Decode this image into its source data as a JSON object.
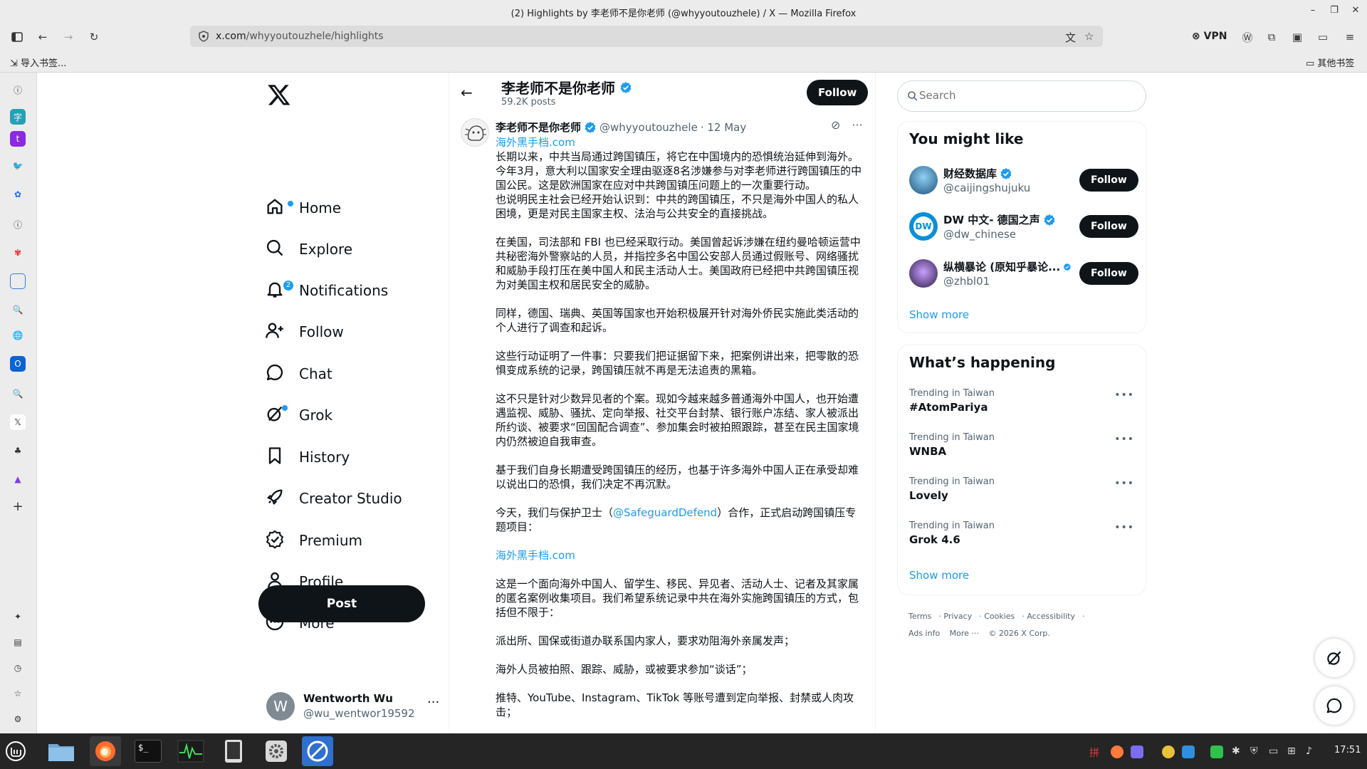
{
  "window": {
    "title": "(2) Highlights by 李老师不是你老师 (@whyyoutouzhele) / X — Mozilla Firefox"
  },
  "browser": {
    "url_domain": "x.com",
    "url_path": "/whyyoutouzhele/highlights",
    "vpn_label": "VPN",
    "bookmarks_import": "导入书签...",
    "bookmarks_other": "其他书签"
  },
  "nav": {
    "items": [
      {
        "label": "Home",
        "icon": "home-icon"
      },
      {
        "label": "Explore",
        "icon": "search-icon"
      },
      {
        "label": "Notifications",
        "icon": "bell-icon",
        "badge": "2"
      },
      {
        "label": "Follow",
        "icon": "add-person-icon"
      },
      {
        "label": "Chat",
        "icon": "chat-icon"
      },
      {
        "label": "Grok",
        "icon": "grok-icon"
      },
      {
        "label": "History",
        "icon": "bookmark-icon"
      },
      {
        "label": "Creator Studio",
        "icon": "rocket-icon"
      },
      {
        "label": "Premium",
        "icon": "verified-icon"
      },
      {
        "label": "Profile",
        "icon": "person-icon"
      },
      {
        "label": "More",
        "icon": "more-circle-icon"
      }
    ],
    "post_label": "Post"
  },
  "account": {
    "initial": "W",
    "name": "Wentworth Wu",
    "handle": "@wu_wentwor19592",
    "more": "···"
  },
  "profile": {
    "name": "李老师不是你老师",
    "posts_count": "59.2K posts",
    "follow_label": "Follow"
  },
  "tweet": {
    "name": "李老师不是你老师",
    "handle": "@whyyoutouzhele",
    "date": "· 12 May",
    "link1": "海外黑手档.com",
    "p1": "长期以来，中共当局通过跨国镇压，将它在中国境内的恐惧统治延伸到海外。今年3月，意大利以国家安全理由驱逐8名涉嫌参与对李老师进行跨国镇压的中国公民。这是欧洲国家在应对中共跨国镇压问题上的一次重要行动。",
    "p1b": "也说明民主社会已经开始认识到：中共的跨国镇压，不只是海外中国人的私人困境，更是对民主国家主权、法治与公共安全的直接挑战。",
    "p2": "在美国，司法部和 FBI 也已经采取行动。美国曾起诉涉嫌在纽约曼哈顿运营中共秘密海外警察站的人员，并指控多名中国公安部人员通过假账号、网络骚扰和威胁手段打压在美中国人和民主活动人士。美国政府已经把中共跨国镇压视为对美国主权和居民安全的威胁。",
    "p3": "同样，德国、瑞典、英国等国家也开始积极展开针对海外侨民实施此类活动的个人进行了调查和起诉。",
    "p4": "这些行动证明了一件事：只要我们把证据留下来，把案例讲出来，把零散的恐惧变成系统的记录，跨国镇压就不再是无法追责的黑箱。",
    "p5": "这不只是针对少数异见者的个案。现如今越来越多普通海外中国人，也开始遭遇监视、威胁、骚扰、定向举报、社交平台封禁、银行账户冻结、家人被派出所约谈、被要求“回国配合调查”、参加集会时被拍照跟踪，甚至在民主国家境内仍然被迫自我审查。",
    "p6": "基于我们自身长期遭受跨国镇压的经历，也基于许多海外中国人正在承受却难以说出口的恐惧，我们决定不再沉默。",
    "p7a": "今天，我们与保护卫士（",
    "p7link": "@SafeguardDefend",
    "p7b": "）合作，正式启动跨国镇压专题项目：",
    "link2": "海外黑手档.com",
    "p8": "这是一个面向海外中国人、留学生、移民、异见者、活动人士、记者及其家属的匿名案例收集项目。我们希望系统记录中共在海外实施跨国镇压的方式，包括但不限于：",
    "p9": "派出所、国保或街道办联系国内家人，要求劝阻海外亲属发声；",
    "p10": "海外人员被拍照、跟踪、威胁，或被要求参加“谈话”；",
    "p11": "推特、YouTube、Instagram、TikTok 等账号遭到定向举报、封禁或人肉攻击；"
  },
  "search": {
    "placeholder": "Search"
  },
  "you_might_like": {
    "title": "You might like",
    "accounts": [
      {
        "name": "财经数据库",
        "handle": "@caijingshujuku",
        "follow": "Follow"
      },
      {
        "name": "DW 中文- 德国之声",
        "handle": "@dw_chinese",
        "follow": "Follow"
      },
      {
        "name": "纵横暴论 (原知乎暴论...",
        "handle": "@zhbl01",
        "follow": "Follow"
      }
    ],
    "show_more": "Show more"
  },
  "whats_happening": {
    "title": "What’s happening",
    "trends": [
      {
        "context": "Trending in Taiwan",
        "topic": "#AtomPariya"
      },
      {
        "context": "Trending in Taiwan",
        "topic": "WNBA"
      },
      {
        "context": "Trending in Taiwan",
        "topic": "Lovely"
      },
      {
        "context": "Trending in Taiwan",
        "topic": "Grok 4.6"
      }
    ],
    "show_more": "Show more"
  },
  "footer": {
    "links": [
      "Terms",
      "Privacy",
      "Cookies",
      "Accessibility",
      "Ads info",
      "More ···",
      "© 2026 X Corp."
    ]
  },
  "taskbar": {
    "clock": "17:51"
  },
  "colors": {
    "accent": "#1d9bf0",
    "button_dark": "#0f1419",
    "secondary_text": "#536471"
  }
}
